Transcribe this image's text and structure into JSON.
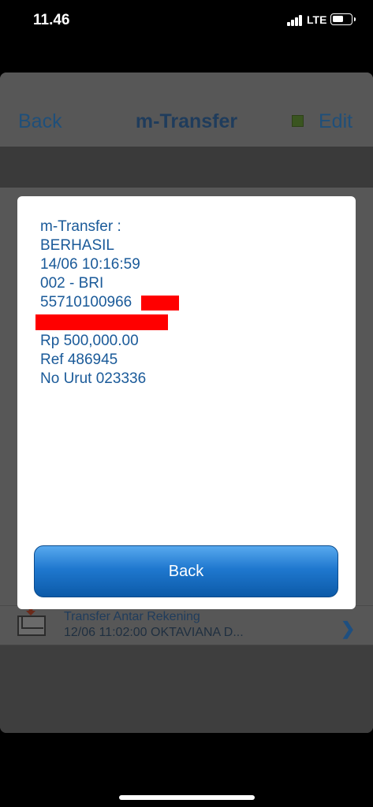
{
  "status_bar": {
    "time": "11.46",
    "network": "LTE"
  },
  "navbar": {
    "back_label": "Back",
    "title": "m-Transfer",
    "edit_label": "Edit"
  },
  "list": {
    "row": {
      "title": "Transfer Antar Rekening",
      "detail": "12/06 11:02:00 OKTAVIANA D..."
    }
  },
  "dialog": {
    "lines": [
      "m-Transfer :",
      "BERHASIL",
      "14/06 10:16:59",
      "002 - BRI",
      "55710100966",
      "Rp 500,000.00",
      "Ref 486945",
      "No Urut 023336"
    ],
    "button_label": "Back"
  },
  "colors": {
    "text_blue": "#1a5a99",
    "redaction": "#ff0000"
  }
}
